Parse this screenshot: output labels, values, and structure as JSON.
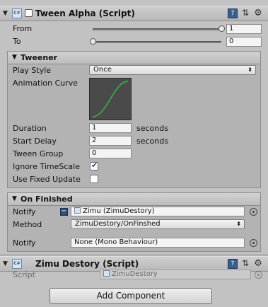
{
  "tween_alpha": {
    "title": "Tween Alpha (Script)",
    "from_label": "From",
    "from_value": "1",
    "from_fraction": 1.0,
    "to_label": "To",
    "to_value": "0",
    "to_fraction": 0.0
  },
  "tweener": {
    "title": "Tweener",
    "play_style_label": "Play Style",
    "play_style_value": "Once",
    "animation_curve_label": "Animation Curve",
    "duration_label": "Duration",
    "duration_value": "1",
    "duration_unit": "seconds",
    "start_delay_label": "Start Delay",
    "start_delay_value": "2",
    "start_delay_unit": "seconds",
    "tween_group_label": "Tween Group",
    "tween_group_value": "0",
    "ignore_timescale_label": "Ignore TimeScale",
    "ignore_timescale_checked": true,
    "use_fixed_update_label": "Use Fixed Update",
    "use_fixed_update_checked": false
  },
  "on_finished": {
    "title": "On Finished",
    "notify_label": "Notify",
    "notify_value": "Zimu (ZimuDestory)",
    "method_label": "Method",
    "method_value": "ZimuDestory/OnFinshed",
    "notify2_label": "Notify",
    "notify2_value": "None (Mono Behaviour)"
  },
  "zimu_destory": {
    "title": "Zimu Destory (Script)",
    "script_label": "Script",
    "script_value": "ZimuDestory"
  },
  "add_component_label": "Add Component",
  "colors": {
    "curve_line": "#2fbf3a",
    "curve_bg": "#4a4a4a",
    "panel_bg": "#c2c2c2"
  }
}
